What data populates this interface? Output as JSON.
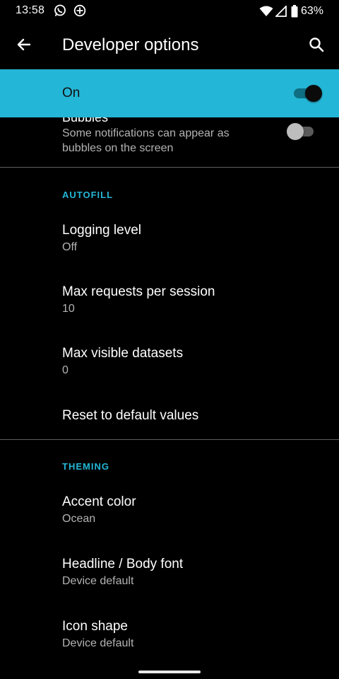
{
  "status_bar": {
    "time": "13:58",
    "app_icons": [
      "whatsapp-icon",
      "sync-icon"
    ],
    "battery": "63%"
  },
  "app_bar": {
    "title": "Developer options"
  },
  "master_switch": {
    "label": "On",
    "checked": true
  },
  "clipped_pref": {
    "title": "Bubbles",
    "summary": "Some notifications can appear as bubbles on the screen",
    "checked": false
  },
  "sections": [
    {
      "header": "AUTOFILL",
      "items": [
        {
          "title": "Logging level",
          "summary": "Off"
        },
        {
          "title": "Max requests per session",
          "summary": "10"
        },
        {
          "title": "Max visible datasets",
          "summary": "0"
        },
        {
          "title": "Reset to default values",
          "summary": ""
        }
      ]
    },
    {
      "header": "THEMING",
      "items": [
        {
          "title": "Accent color",
          "summary": "Ocean"
        },
        {
          "title": "Headline / Body font",
          "summary": "Device default"
        },
        {
          "title": "Icon shape",
          "summary": "Device default"
        }
      ]
    }
  ],
  "colors": {
    "accent": "#24b6d6",
    "background": "#000000",
    "secondary_text": "#b3b3b3"
  }
}
